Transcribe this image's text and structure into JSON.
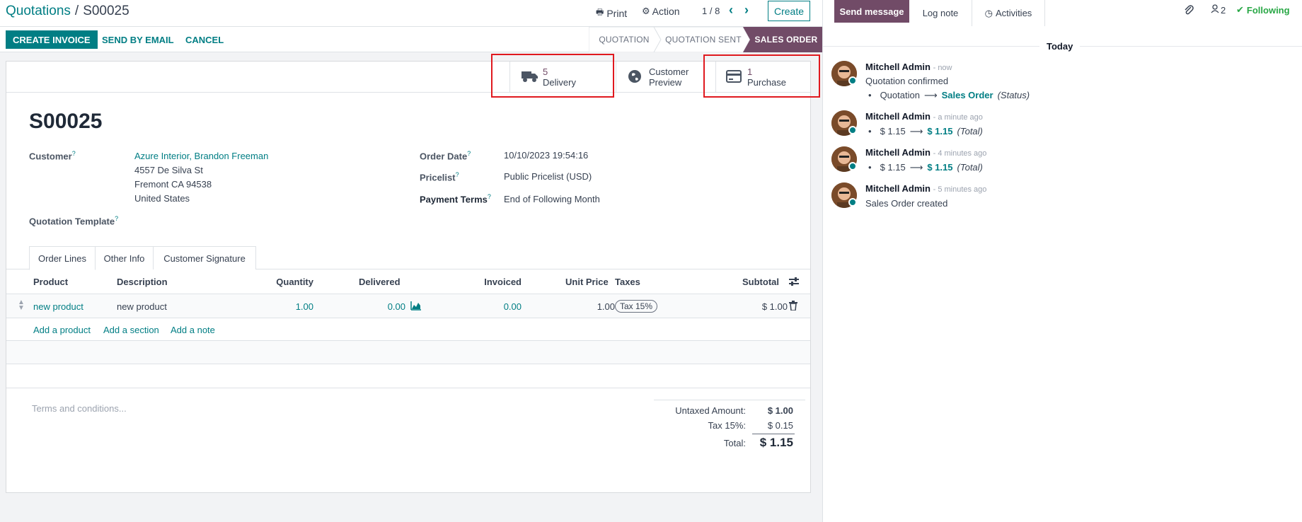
{
  "header": {
    "breadcrumb_parent": "Quotations",
    "breadcrumb_sep": "/",
    "breadcrumb_current": "S00025",
    "print_label": "Print",
    "action_label": "Action",
    "pager": "1 / 8",
    "create_label": "Create"
  },
  "statusbar": {
    "create_invoice": "CREATE INVOICE",
    "send_by_email": "SEND BY EMAIL",
    "cancel": "CANCEL",
    "stages": [
      "QUOTATION",
      "QUOTATION SENT",
      "SALES ORDER"
    ],
    "active_stage": "SALES ORDER"
  },
  "smart_buttons": {
    "delivery_count": "5",
    "delivery_label": "Delivery",
    "preview_line1": "Customer",
    "preview_line2": "Preview",
    "purchase_count": "1",
    "purchase_label": "Purchase"
  },
  "form": {
    "name": "S00025",
    "customer_label": "Customer",
    "customer_name": "Azure Interior, Brandon Freeman",
    "address1": "4557 De Silva St",
    "address2": "Fremont CA 94538",
    "address3": "United States",
    "template_label": "Quotation Template",
    "order_date_label": "Order Date",
    "order_date": "10/10/2023 19:54:16",
    "pricelist_label": "Pricelist",
    "pricelist": "Public Pricelist (USD)",
    "payment_terms_label": "Payment Terms",
    "payment_terms": "End of Following Month",
    "help_mark": "?"
  },
  "tabs": [
    "Order Lines",
    "Other Info",
    "Customer Signature"
  ],
  "table": {
    "headers": {
      "product": "Product",
      "description": "Description",
      "quantity": "Quantity",
      "delivered": "Delivered",
      "invoiced": "Invoiced",
      "unit_price": "Unit Price",
      "taxes": "Taxes",
      "subtotal": "Subtotal"
    },
    "rows": [
      {
        "product": "new product",
        "description": "new product",
        "quantity": "1.00",
        "delivered": "0.00",
        "invoiced": "0.00",
        "unit_price": "1.00",
        "tax": "Tax 15%",
        "subtotal": "$ 1.00"
      }
    ],
    "add_product": "Add a product",
    "add_section": "Add a section",
    "add_note": "Add a note"
  },
  "footer": {
    "terms_placeholder": "Terms and conditions...",
    "untaxed_label": "Untaxed Amount:",
    "untaxed_value": "$ 1.00",
    "tax_label": "Tax 15%:",
    "tax_value": "$ 0.15",
    "total_label": "Total:",
    "total_value": "$ 1.15"
  },
  "chatter": {
    "send_message": "Send message",
    "log_note": "Log note",
    "activities": "Activities",
    "followers_count": "2",
    "following": "Following",
    "date_separator": "Today",
    "messages": [
      {
        "author": "Mitchell Admin",
        "when": "- now",
        "text": "Quotation confirmed",
        "old": "Quotation",
        "new": "Sales Order",
        "field": "(Status)"
      },
      {
        "author": "Mitchell Admin",
        "when": "- a minute ago",
        "old": "$ 1.15",
        "new": "$ 1.15",
        "field": "(Total)"
      },
      {
        "author": "Mitchell Admin",
        "when": "- 4 minutes ago",
        "old": "$ 1.15",
        "new": "$ 1.15",
        "field": "(Total)"
      },
      {
        "author": "Mitchell Admin",
        "when": "- 5 minutes ago",
        "text": "Sales Order created"
      }
    ]
  },
  "colors": {
    "primary": "#017e84",
    "brand": "#714b67",
    "highlight": "#e0191f",
    "following": "#28a745"
  }
}
